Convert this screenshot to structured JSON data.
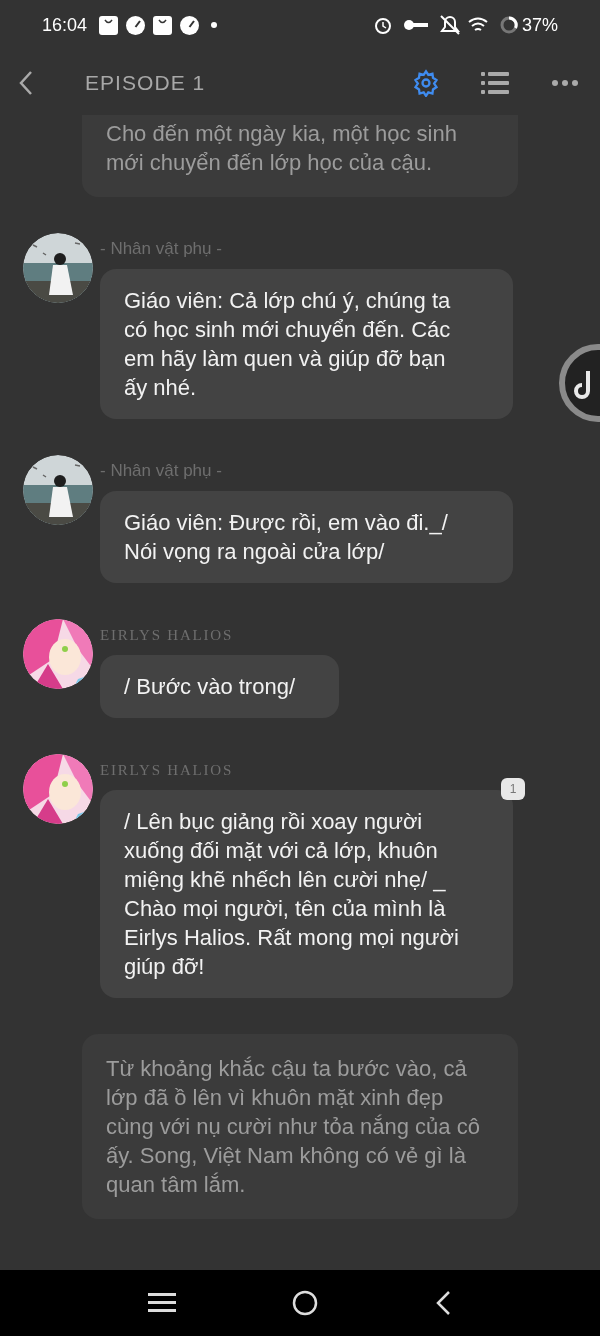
{
  "status_bar": {
    "time": "16:04",
    "battery": "37%"
  },
  "header": {
    "title": "EPISODE 1",
    "settings_active": true
  },
  "messages": [
    {
      "kind": "narration",
      "text": "Cho đến một ngày kia, một học sinh mới chuyển đến lớp học của cậu."
    },
    {
      "kind": "dialogue",
      "speaker": "- Nhân vật phụ -",
      "text": "Giáo viên: Cả lớp chú ý, chúng ta có học sinh mới chuyển đến. Các em hãy làm quen và giúp đỡ bạn ấy nhé."
    },
    {
      "kind": "dialogue",
      "speaker": "- Nhân vật phụ -",
      "text": "Giáo viên: Được rồi, em vào đi._/ Nói vọng ra ngoài cửa lớp/"
    },
    {
      "kind": "dialogue",
      "speaker": "EIRLYS HALIOS",
      "text": "/ Bước vào trong/"
    },
    {
      "kind": "dialogue",
      "speaker": "EIRLYS HALIOS",
      "text": "/ Lên bục giảng rồi xoay người xuống đối mặt với cả lớp, khuôn miệng khẽ nhếch lên cười nhẹ/ _ Chào mọi người, tên của mình là Eirlys Halios. Rất mong mọi người giúp đỡ!",
      "badge": "1"
    },
    {
      "kind": "narration",
      "text": "Từ khoảng khắc cậu ta bước vào, cả lớp đã ồ lên vì khuôn mặt xinh đẹp cùng với nụ cười như tỏa nắng của cô ấy. Song, Việt Nam không có vẻ gì là quan tâm lắm."
    }
  ]
}
